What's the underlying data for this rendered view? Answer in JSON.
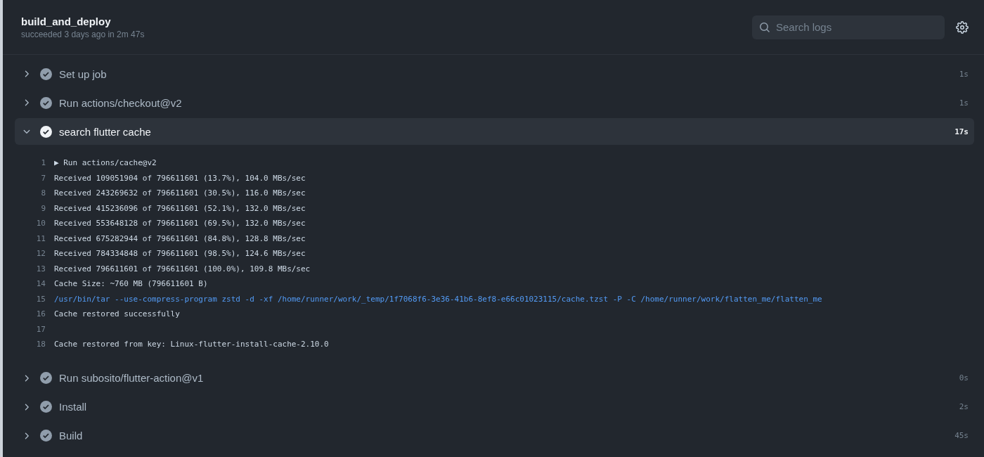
{
  "header": {
    "title": "build_and_deploy",
    "subtitle": "succeeded 3 days ago in 2m 47s"
  },
  "search": {
    "placeholder": "Search logs"
  },
  "steps": [
    {
      "name": "Set up job",
      "duration": "1s",
      "expanded": false
    },
    {
      "name": "Run actions/checkout@v2",
      "duration": "1s",
      "expanded": false
    },
    {
      "name": "search flutter cache",
      "duration": "17s",
      "expanded": true,
      "log": [
        {
          "number": "1",
          "kind": "group",
          "marker": "▶",
          "text": "Run actions/cache@v2"
        },
        {
          "number": "7",
          "kind": "plain",
          "text": "Received 109051904 of 796611601 (13.7%), 104.0 MBs/sec"
        },
        {
          "number": "8",
          "kind": "plain",
          "text": "Received 243269632 of 796611601 (30.5%), 116.0 MBs/sec"
        },
        {
          "number": "9",
          "kind": "plain",
          "text": "Received 415236096 of 796611601 (52.1%), 132.0 MBs/sec"
        },
        {
          "number": "10",
          "kind": "plain",
          "text": "Received 553648128 of 796611601 (69.5%), 132.0 MBs/sec"
        },
        {
          "number": "11",
          "kind": "plain",
          "text": "Received 675282944 of 796611601 (84.8%), 128.8 MBs/sec"
        },
        {
          "number": "12",
          "kind": "plain",
          "text": "Received 784334848 of 796611601 (98.5%), 124.6 MBs/sec"
        },
        {
          "number": "13",
          "kind": "plain",
          "text": "Received 796611601 of 796611601 (100.0%), 109.8 MBs/sec"
        },
        {
          "number": "14",
          "kind": "plain",
          "text": "Cache Size: ~760 MB (796611601 B)"
        },
        {
          "number": "15",
          "kind": "command",
          "text": "/usr/bin/tar --use-compress-program zstd -d -xf /home/runner/work/_temp/1f7068f6-3e36-41b6-8ef8-e66c01023115/cache.tzst -P -C /home/runner/work/flatten_me/flatten_me"
        },
        {
          "number": "16",
          "kind": "plain",
          "text": "Cache restored successfully"
        },
        {
          "number": "17"
        },
        {
          "number": "18",
          "kind": "plain",
          "text": "Cache restored from key: Linux-flutter-install-cache-2.10.0"
        }
      ]
    },
    {
      "name": "Run subosito/flutter-action@v1",
      "duration": "0s",
      "expanded": false
    },
    {
      "name": "Install",
      "duration": "2s",
      "expanded": false
    },
    {
      "name": "Build",
      "duration": "45s",
      "expanded": false
    }
  ]
}
